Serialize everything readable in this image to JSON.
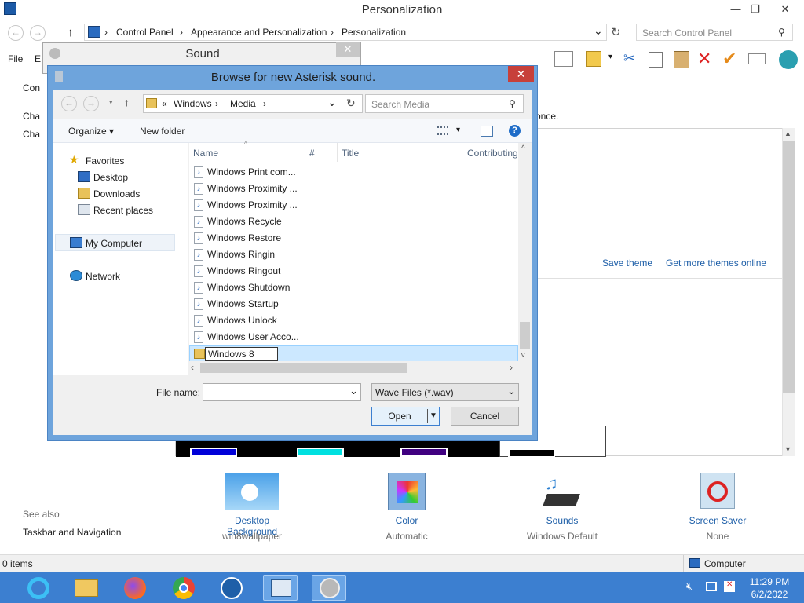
{
  "window": {
    "title": "Personalization",
    "minimize": "—",
    "restore": "❐",
    "close": "✕"
  },
  "address": {
    "back": "←",
    "forward": "→",
    "up": "↑",
    "crumbs": [
      "Control Panel",
      "Appearance and Personalization",
      "Personalization"
    ],
    "sep": "›",
    "dropdown": "⌄",
    "refresh": "↻",
    "search_placeholder": "Search Control Panel"
  },
  "menubar": {
    "file": "File",
    "edit_partial": "E"
  },
  "left_partial": {
    "con": "Con",
    "cha1": "Cha",
    "cha2": "Cha"
  },
  "text_partial": "once.",
  "theme_links": {
    "save_theme": "Save theme",
    "get_more": "Get more themes online"
  },
  "see_also": {
    "heading": "See also",
    "taskbar": "Taskbar and Navigation"
  },
  "bottom_items": [
    {
      "label": "Desktop Background",
      "sub": "win8wallpaper"
    },
    {
      "label": "Color",
      "sub": "Automatic"
    },
    {
      "label": "Sounds",
      "sub": "Windows Default"
    },
    {
      "label": "Screen Saver",
      "sub": "None"
    }
  ],
  "status": {
    "items": "0 items",
    "computer": "Computer"
  },
  "sound_dialog": {
    "title": "Sound",
    "close": "✕"
  },
  "browse": {
    "title": "Browse for new Asterisk sound.",
    "close": "✕",
    "path": [
      "«",
      "Windows",
      "Media"
    ],
    "search_placeholder": "Search Media",
    "organize": "Organize ▾",
    "new_folder": "New folder",
    "help": "?",
    "columns": {
      "name": "Name",
      "number": "#",
      "title": "Title",
      "contributing": "Contributing"
    },
    "nav": {
      "favorites": "Favorites",
      "desktop": "Desktop",
      "downloads": "Downloads",
      "recent": "Recent places",
      "computer": "My Computer",
      "network": "Network"
    },
    "files": [
      "Windows Print com...",
      "Windows Proximity ...",
      "Windows Proximity ...",
      "Windows Recycle",
      "Windows Restore",
      "Windows Ringin",
      "Windows Ringout",
      "Windows Shutdown",
      "Windows Startup",
      "Windows Unlock",
      "Windows User Acco..."
    ],
    "editing_folder": "Windows 8",
    "file_name_label": "File name:",
    "file_name_value": "",
    "file_type": "Wave Files (*.wav)",
    "open": "Open",
    "cancel": "Cancel"
  },
  "clock": {
    "time": "11:29 PM",
    "date": "6/2/2022"
  },
  "colors": {
    "taskbar": "#3c7fd0",
    "dialog_frame": "#6ea4dc",
    "close_red": "#c7403a",
    "selection": "#cce8ff"
  }
}
